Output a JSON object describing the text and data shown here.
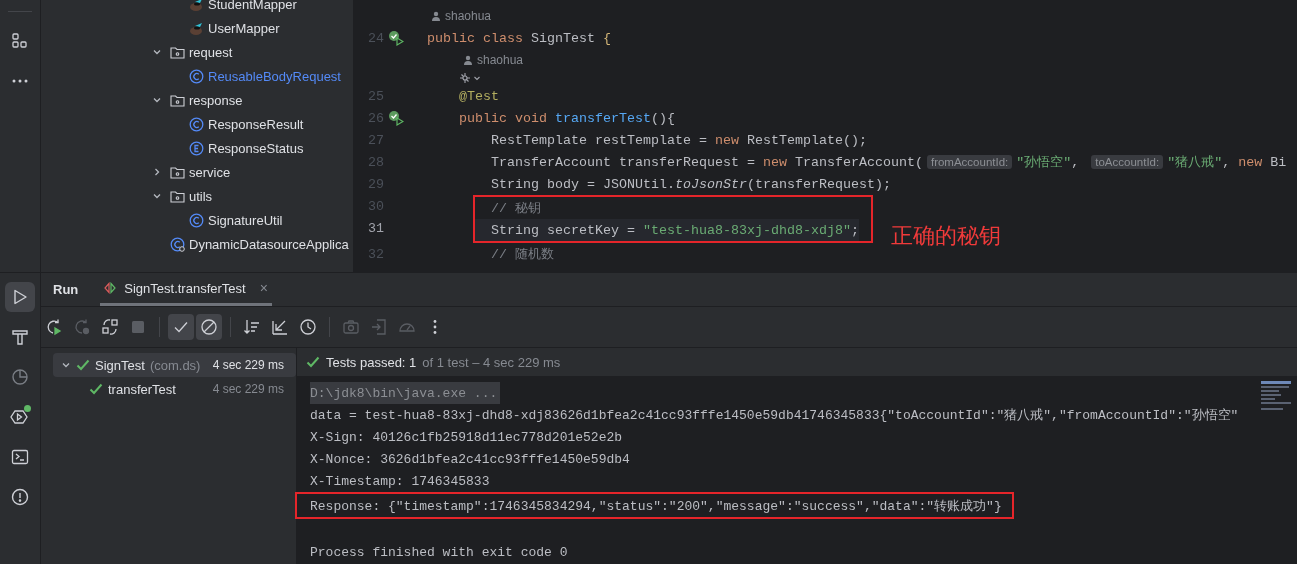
{
  "tool_windows_top": [
    {
      "kind": "structure"
    },
    {
      "kind": "more"
    }
  ],
  "project_tree": [
    {
      "children": [
        {
          "children": [
            {
              "children": [
                {
                  "label": "StudentMapper",
                  "kind": "mapper",
                  "modified": false
                },
                {
                  "label": "UserMapper",
                  "kind": "mapper",
                  "modified": false
                }
              ]
            },
            {
              "label": "request",
              "kind": "folder",
              "expanded": true,
              "modified": false,
              "children": [
                {
                  "label": "ReusableBodyRequest",
                  "kind": "class",
                  "modified": true
                }
              ]
            },
            {
              "label": "response",
              "kind": "folder",
              "expanded": true,
              "modified": false,
              "children": [
                {
                  "label": "ResponseResult",
                  "kind": "class",
                  "modified": false
                },
                {
                  "label": "ResponseStatus",
                  "kind": "enum",
                  "modified": false
                }
              ]
            },
            {
              "label": "service",
              "kind": "folder",
              "expanded": false,
              "modified": false
            },
            {
              "label": "utils",
              "kind": "folder",
              "expanded": true,
              "modified": false,
              "children": [
                {
                  "label": "SignatureUtil",
                  "kind": "class",
                  "modified": false
                }
              ]
            },
            {
              "label": "DynamicDatasourceApplica",
              "kind": "app",
              "modified": false
            }
          ]
        }
      ]
    }
  ],
  "editor": {
    "lines": [
      {
        "number": "24",
        "author": "shaohua",
        "inlay_icon": false,
        "run_icon": true,
        "current": false,
        "boxed": false,
        "tokens": [
          {
            "kind": "kw",
            "text": "public class "
          },
          {
            "kind": "plain",
            "text": "SignTest "
          },
          {
            "kind": "brace",
            "text": "{"
          }
        ]
      },
      {
        "number": "25",
        "author": "shaohua",
        "inlay_icon": true,
        "run_icon": false,
        "current": false,
        "boxed": false,
        "tokens": [
          {
            "kind": "annotation",
            "text": "    @Test"
          }
        ]
      },
      {
        "number": "26",
        "inlay_icon": false,
        "run_icon": true,
        "current": false,
        "boxed": false,
        "tokens": [
          {
            "kind": "kw",
            "text": "    public void "
          },
          {
            "kind": "method",
            "text": "transferTest"
          },
          {
            "kind": "plain",
            "text": "(){"
          }
        ]
      },
      {
        "number": "27",
        "inlay_icon": false,
        "run_icon": false,
        "current": false,
        "boxed": false,
        "tokens": [
          {
            "kind": "plain",
            "text": "        RestTemplate restTemplate = "
          },
          {
            "kind": "kw",
            "text": "new "
          },
          {
            "kind": "plain",
            "text": "RestTemplate();"
          }
        ]
      },
      {
        "number": "28",
        "inlay_icon": false,
        "run_icon": false,
        "current": false,
        "boxed": false,
        "tokens": [
          {
            "kind": "plain",
            "text": "        TransferAccount transferRequest = "
          },
          {
            "kind": "kw",
            "text": "new "
          },
          {
            "kind": "plain",
            "text": "TransferAccount("
          },
          {
            "kind": "hint",
            "text": "fromAccountId:"
          },
          {
            "kind": "string",
            "text": "\"孙悟空\""
          },
          {
            "kind": "plain",
            "text": ", "
          },
          {
            "kind": "hint",
            "text": "toAccountId:"
          },
          {
            "kind": "string",
            "text": "\"猪八戒\""
          },
          {
            "kind": "plain",
            "text": ", "
          },
          {
            "kind": "kw",
            "text": "new "
          },
          {
            "kind": "plain",
            "text": "Bi"
          }
        ]
      },
      {
        "number": "29",
        "inlay_icon": false,
        "run_icon": false,
        "current": false,
        "boxed": false,
        "tokens": [
          {
            "kind": "plain",
            "text": "        String body = JSONUtil."
          },
          {
            "kind": "static",
            "text": "toJsonStr"
          },
          {
            "kind": "plain",
            "text": "(transferRequest);"
          }
        ]
      },
      {
        "number": "30",
        "inlay_icon": false,
        "run_icon": false,
        "current": false,
        "boxed": true,
        "tokens": [
          {
            "kind": "comment",
            "text": "        // 秘钥"
          }
        ]
      },
      {
        "number": "31",
        "inlay_icon": false,
        "run_icon": false,
        "current": true,
        "boxed": true,
        "callout": "正确的秘钥",
        "tokens": [
          {
            "kind": "plain",
            "text": "        String secretKey = "
          },
          {
            "kind": "string",
            "text": "\"test-hua8-83xj-dhd8-xdj8\""
          },
          {
            "kind": "plain",
            "text": ";"
          }
        ]
      },
      {
        "number": "32",
        "inlay_icon": false,
        "run_icon": false,
        "current": false,
        "boxed": false,
        "tokens": [
          {
            "kind": "comment",
            "text": "        // 随机数"
          }
        ]
      }
    ]
  },
  "tool_windows_bottom": [
    {
      "kind": "run",
      "selected": true,
      "badge": false
    },
    {
      "kind": "build",
      "selected": false,
      "badge": false
    },
    {
      "kind": "profiler",
      "selected": false,
      "badge": false
    },
    {
      "kind": "services",
      "selected": false,
      "badge": true
    },
    {
      "kind": "terminal",
      "selected": false,
      "badge": false
    },
    {
      "kind": "problems",
      "selected": false,
      "badge": false
    }
  ],
  "run_panel": {
    "title": "Run",
    "tabs": [
      {
        "label": "SignTest.transferTest",
        "close": "×",
        "selected": true
      }
    ],
    "toolbar": [
      {
        "kind": "rerun",
        "disabled": false
      },
      {
        "kind": "rerun_failed",
        "disabled": true
      },
      {
        "kind": "toggle_auto",
        "disabled": false
      },
      {
        "kind": "stop",
        "disabled": true
      },
      {
        "kind": "separator"
      },
      {
        "kind": "show_passed",
        "disabled": false,
        "on": true
      },
      {
        "kind": "show_ignored",
        "disabled": false,
        "on": true
      },
      {
        "kind": "separator"
      },
      {
        "kind": "sort",
        "disabled": false
      },
      {
        "kind": "collapse",
        "disabled": false
      },
      {
        "kind": "history",
        "disabled": false
      },
      {
        "kind": "separator"
      },
      {
        "kind": "screenshot",
        "disabled": true
      },
      {
        "kind": "import",
        "disabled": true
      },
      {
        "kind": "gauge",
        "disabled": true
      },
      {
        "kind": "more",
        "disabled": false
      }
    ],
    "tests": [
      {
        "label": "SignTest",
        "package": "(com.ds)",
        "duration": "4 sec 229 ms",
        "passed": true,
        "selected": true,
        "expanded": true,
        "children": [
          {
            "label": "transferTest",
            "duration": "4 sec 229 ms",
            "passed": true,
            "selected": false
          }
        ]
      }
    ],
    "summary": {
      "passed": true,
      "label": "Tests passed: 1",
      "detail": "of 1 test – 4 sec 229 ms"
    },
    "console": [
      {
        "kind": "command",
        "boxed": false,
        "text": "D:\\jdk8\\bin\\java.exe ..."
      },
      {
        "kind": "output",
        "boxed": false,
        "text": "data = test-hua8-83xj-dhd8-xdj83626d1bfea2c41cc93fffe1450e59db41746345833{\"toAccountId\":\"猪八戒\",\"fromAccountId\":\"孙悟空\""
      },
      {
        "kind": "output",
        "boxed": false,
        "text": "X-Sign: 40126c1fb25918d11ec778d201e52e2b"
      },
      {
        "kind": "output",
        "boxed": false,
        "text": "X-Nonce: 3626d1bfea2c41cc93fffe1450e59db4"
      },
      {
        "kind": "output",
        "boxed": false,
        "text": "X-Timestamp: 1746345833"
      },
      {
        "kind": "output",
        "boxed": true,
        "text": "Response: {\"timestamp\":1746345834294,\"status\":\"200\",\"message\":\"success\",\"data\":\"转账成功\"}"
      },
      {
        "kind": "exit",
        "boxed": false,
        "text": "Process finished with exit code 0"
      }
    ]
  }
}
